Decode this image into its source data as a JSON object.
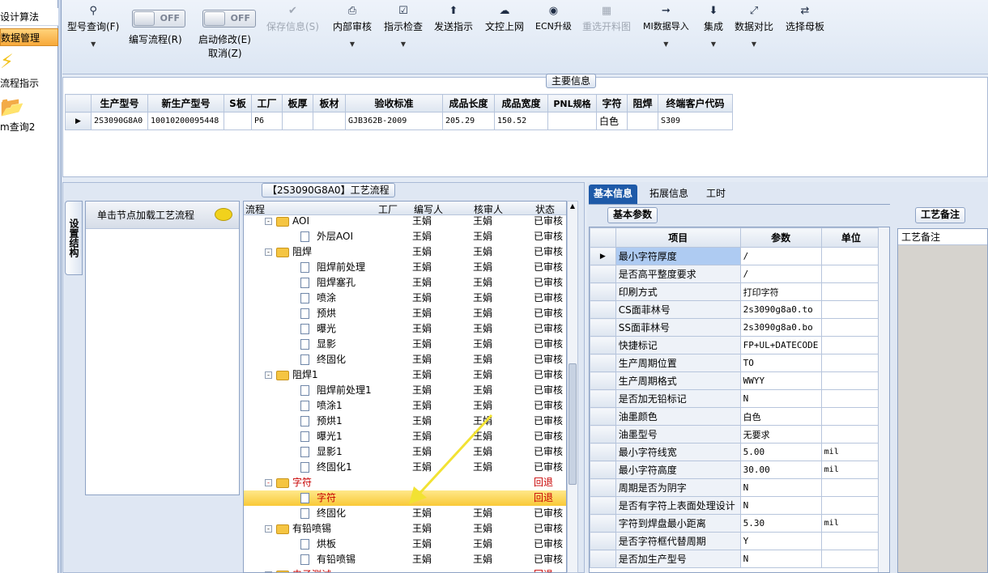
{
  "left_nav": {
    "items": [
      {
        "label": "设计算法"
      },
      {
        "label": "数据管理"
      },
      {
        "label": "流程指示"
      },
      {
        "label": "m查询2"
      }
    ]
  },
  "toolbar": {
    "buttons": [
      {
        "label": "型号查询(F)",
        "icon": "search-icon",
        "disabled": false
      },
      {
        "label": "保存信息(S)",
        "icon": "check-icon",
        "disabled": true
      },
      {
        "label": "内部审核",
        "icon": "printer-icon",
        "disabled": false
      },
      {
        "label": "指示检查",
        "icon": "checkbox-icon",
        "disabled": false
      },
      {
        "label": "发送指示",
        "icon": "upload-icon",
        "disabled": false
      },
      {
        "label": "文控上网",
        "icon": "cloud-upload-icon",
        "disabled": false
      },
      {
        "label": "ECN升级",
        "icon": "binoculars-icon",
        "disabled": false
      },
      {
        "label": "重选开料图",
        "icon": "picture-icon",
        "disabled": true
      },
      {
        "label": "MI数据导入",
        "icon": "import-icon",
        "disabled": false
      },
      {
        "label": "集成",
        "icon": "download-icon",
        "disabled": false
      },
      {
        "label": "数据对比",
        "icon": "compress-icon",
        "disabled": false
      },
      {
        "label": "选择母板",
        "icon": "shuffle-icon",
        "disabled": false
      }
    ],
    "toggles": [
      {
        "state": "OFF",
        "label": "编写流程(R)"
      },
      {
        "state": "OFF",
        "label": "启动修改(E)",
        "sub": "取消(Z)"
      }
    ]
  },
  "main_info": {
    "title": "主要信息",
    "columns": [
      "生产型号",
      "新生产型号",
      "S板",
      "工厂",
      "板厚",
      "板材",
      "验收标准",
      "成品长度",
      "成品宽度",
      "PNL规格",
      "字符",
      "阻焊",
      "终端客户代码"
    ],
    "rows": [
      [
        "2S3090G8A0",
        "10010200095448",
        "",
        "P6",
        "",
        "",
        "GJB362B-2009",
        "205.29",
        "150.52",
        "",
        "白色",
        "",
        "S309"
      ]
    ]
  },
  "process": {
    "title": "【2S3090G8A0】工艺流程",
    "side_tab": "设置结构",
    "click_hint": "单击节点加载工艺流程",
    "tree_columns": [
      "流程",
      "工厂",
      "编写人",
      "核审人",
      "状态"
    ],
    "rows": [
      {
        "level": 1,
        "type": "folder",
        "name": "AOI",
        "writer": "王娟",
        "reviewer": "王娟",
        "status": "已审核",
        "red": false,
        "selected": false
      },
      {
        "level": 2,
        "type": "doc",
        "name": "外层AOI",
        "writer": "王娟",
        "reviewer": "王娟",
        "status": "已审核",
        "red": false,
        "selected": false
      },
      {
        "level": 1,
        "type": "folder",
        "name": "阻焊",
        "writer": "王娟",
        "reviewer": "王娟",
        "status": "已审核",
        "red": false,
        "selected": false
      },
      {
        "level": 2,
        "type": "doc",
        "name": "阻焊前处理",
        "writer": "王娟",
        "reviewer": "王娟",
        "status": "已审核",
        "red": false,
        "selected": false
      },
      {
        "level": 2,
        "type": "doc",
        "name": "阻焊塞孔",
        "writer": "王娟",
        "reviewer": "王娟",
        "status": "已审核",
        "red": false,
        "selected": false
      },
      {
        "level": 2,
        "type": "doc",
        "name": "喷涂",
        "writer": "王娟",
        "reviewer": "王娟",
        "status": "已审核",
        "red": false,
        "selected": false
      },
      {
        "level": 2,
        "type": "doc",
        "name": "预烘",
        "writer": "王娟",
        "reviewer": "王娟",
        "status": "已审核",
        "red": false,
        "selected": false
      },
      {
        "level": 2,
        "type": "doc",
        "name": "曝光",
        "writer": "王娟",
        "reviewer": "王娟",
        "status": "已审核",
        "red": false,
        "selected": false
      },
      {
        "level": 2,
        "type": "doc",
        "name": "显影",
        "writer": "王娟",
        "reviewer": "王娟",
        "status": "已审核",
        "red": false,
        "selected": false
      },
      {
        "level": 2,
        "type": "doc",
        "name": "终固化",
        "writer": "王娟",
        "reviewer": "王娟",
        "status": "已审核",
        "red": false,
        "selected": false
      },
      {
        "level": 1,
        "type": "folder",
        "name": "阻焊1",
        "writer": "王娟",
        "reviewer": "王娟",
        "status": "已审核",
        "red": false,
        "selected": false
      },
      {
        "level": 2,
        "type": "doc",
        "name": "阻焊前处理1",
        "writer": "王娟",
        "reviewer": "王娟",
        "status": "已审核",
        "red": false,
        "selected": false
      },
      {
        "level": 2,
        "type": "doc",
        "name": "喷涂1",
        "writer": "王娟",
        "reviewer": "王娟",
        "status": "已审核",
        "red": false,
        "selected": false
      },
      {
        "level": 2,
        "type": "doc",
        "name": "预烘1",
        "writer": "王娟",
        "reviewer": "王娟",
        "status": "已审核",
        "red": false,
        "selected": false
      },
      {
        "level": 2,
        "type": "doc",
        "name": "曝光1",
        "writer": "王娟",
        "reviewer": "王娟",
        "status": "已审核",
        "red": false,
        "selected": false
      },
      {
        "level": 2,
        "type": "doc",
        "name": "显影1",
        "writer": "王娟",
        "reviewer": "王娟",
        "status": "已审核",
        "red": false,
        "selected": false
      },
      {
        "level": 2,
        "type": "doc",
        "name": "终固化1",
        "writer": "王娟",
        "reviewer": "王娟",
        "status": "已审核",
        "red": false,
        "selected": false
      },
      {
        "level": 1,
        "type": "folder",
        "name": "字符",
        "writer": "",
        "reviewer": "",
        "status": "回退",
        "red": true,
        "selected": false
      },
      {
        "level": 2,
        "type": "doc",
        "name": "字符",
        "writer": "",
        "reviewer": "",
        "status": "回退",
        "red": true,
        "selected": true
      },
      {
        "level": 2,
        "type": "doc",
        "name": "终固化",
        "writer": "王娟",
        "reviewer": "王娟",
        "status": "已审核",
        "red": false,
        "selected": false
      },
      {
        "level": 1,
        "type": "folder",
        "name": "有铅喷锡",
        "writer": "王娟",
        "reviewer": "王娟",
        "status": "已审核",
        "red": false,
        "selected": false
      },
      {
        "level": 2,
        "type": "doc",
        "name": "烘板",
        "writer": "王娟",
        "reviewer": "王娟",
        "status": "已审核",
        "red": false,
        "selected": false
      },
      {
        "level": 2,
        "type": "doc",
        "name": "有铅喷锡",
        "writer": "王娟",
        "reviewer": "王娟",
        "status": "已审核",
        "red": false,
        "selected": false
      },
      {
        "level": 1,
        "type": "folder",
        "name": "电子测试",
        "writer": "",
        "reviewer": "",
        "status": "回退",
        "red": true,
        "selected": false
      }
    ]
  },
  "right_panel": {
    "tabs": [
      "基本信息",
      "拓展信息",
      "工时"
    ],
    "sub_tab": "基本参数",
    "note_tab": "工艺备注",
    "note_header": "工艺备注",
    "param_columns": [
      "项目",
      "参数",
      "单位"
    ],
    "params": [
      {
        "item": "最小字符厚度",
        "value": "/",
        "unit": ""
      },
      {
        "item": "是否高平整度要求",
        "value": "/",
        "unit": ""
      },
      {
        "item": "印刷方式",
        "value": "打印字符",
        "unit": ""
      },
      {
        "item": "CS面菲林号",
        "value": "2s3090g8a0.to",
        "unit": ""
      },
      {
        "item": "SS面菲林号",
        "value": "2s3090g8a0.bo",
        "unit": ""
      },
      {
        "item": "快捷标记",
        "value": "FP+UL+DATECODE",
        "unit": ""
      },
      {
        "item": "生产周期位置",
        "value": "TO",
        "unit": ""
      },
      {
        "item": "生产周期格式",
        "value": "WWYY",
        "unit": ""
      },
      {
        "item": "是否加无铅标记",
        "value": "N",
        "unit": ""
      },
      {
        "item": "油墨颜色",
        "value": "白色",
        "unit": ""
      },
      {
        "item": "油墨型号",
        "value": "无要求",
        "unit": ""
      },
      {
        "item": "最小字符线宽",
        "value": "5.00",
        "unit": "mil"
      },
      {
        "item": "最小字符高度",
        "value": "30.00",
        "unit": "mil"
      },
      {
        "item": "周期是否为阴字",
        "value": "N",
        "unit": ""
      },
      {
        "item": "是否有字符上表面处理设计",
        "value": "N",
        "unit": ""
      },
      {
        "item": "字符到焊盘最小距离",
        "value": "5.30",
        "unit": "mil"
      },
      {
        "item": "是否字符框代替周期",
        "value": "Y",
        "unit": ""
      },
      {
        "item": "是否加生产型号",
        "value": "N",
        "unit": ""
      }
    ]
  },
  "colors": {
    "accent": "#f7a93a",
    "selected_row": "#ffd84a",
    "rollback_text": "#c80000",
    "active_tab": "#1e5aa8",
    "annotation_arrow": "#f2e233"
  }
}
